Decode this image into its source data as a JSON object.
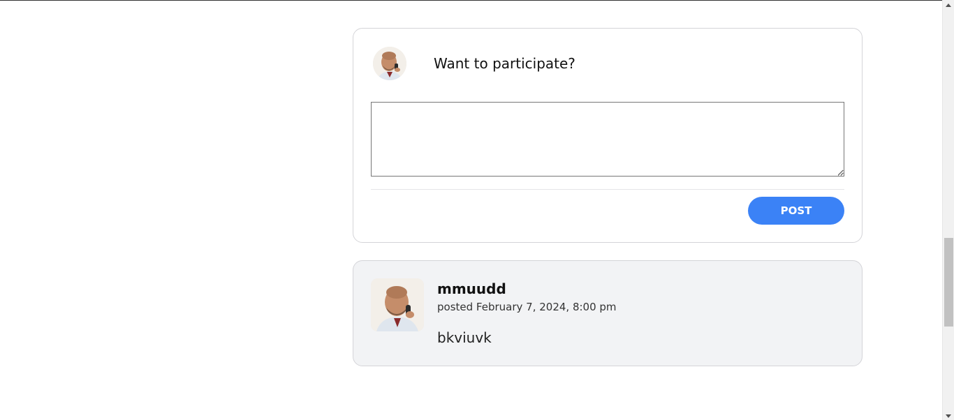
{
  "composer": {
    "prompt": "Want to participate?",
    "textarea_value": "",
    "post_label": "POST"
  },
  "comment": {
    "username": "mmuudd",
    "posted": "posted February 7, 2024, 8:00 pm",
    "body": "bkviuvk"
  },
  "colors": {
    "accent": "#3b82f6",
    "card_border": "#d4d4d8",
    "comment_bg": "#f2f3f5"
  },
  "icons": {
    "avatar": "user-avatar-photo"
  }
}
